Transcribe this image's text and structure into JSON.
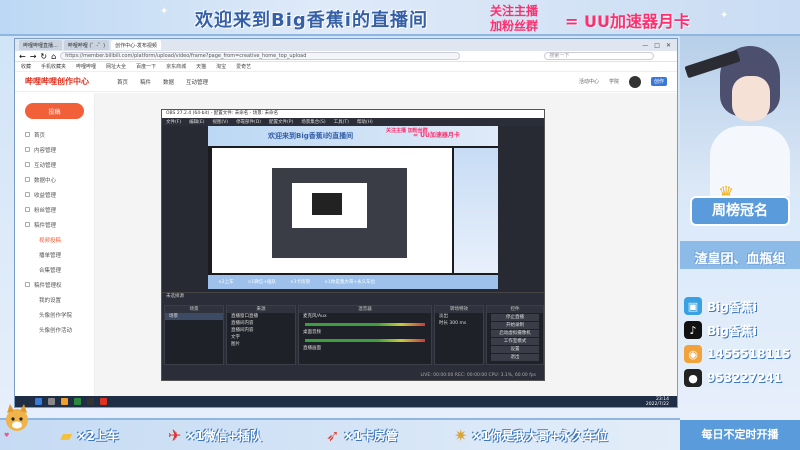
{
  "overlay": {
    "welcome": "欢迎来到Big香蕉i的直播间",
    "promo_line1": "关注主播",
    "promo_line2": "加粉丝群",
    "promo_reward": "= UU加速器月卡"
  },
  "browser": {
    "tabs": [
      "哔哩哔哩直播...",
      "哔哩哔哩 (゜-゜)",
      "创作中心-发布视频"
    ],
    "url": "https://member.bilibili.com/platform/upload/video/frame?page_from=creative_home_top_upload",
    "search_placeholder": "搜索一下",
    "bookmarks": [
      "收藏",
      "手机收藏夹",
      "哔哩哔哩",
      "网址大全",
      "百度一下",
      "京东商城",
      "天猫",
      "淘宝",
      "爱奇艺"
    ],
    "site_logo": "哔哩哔哩创作中心",
    "site_nav": [
      "首页",
      "稿件",
      "数据",
      "互动管理"
    ],
    "site_user_links": [
      "活动中心",
      "学院"
    ],
    "site_badge": "创作"
  },
  "sidebar": {
    "publish_label": "投稿",
    "items": [
      {
        "label": "首页",
        "sub": false,
        "active": false
      },
      {
        "label": "内容管理",
        "sub": false,
        "active": false
      },
      {
        "label": "互动管理",
        "sub": false,
        "active": false
      },
      {
        "label": "数据中心",
        "sub": false,
        "active": false
      },
      {
        "label": "收益管理",
        "sub": false,
        "active": false
      },
      {
        "label": "粉丝管理",
        "sub": false,
        "active": false
      },
      {
        "label": "稿件管理",
        "sub": false,
        "active": false
      },
      {
        "label": "视频投稿",
        "sub": true,
        "active": true
      },
      {
        "label": "播单管理",
        "sub": true,
        "active": false
      },
      {
        "label": "合集管理",
        "sub": true,
        "active": false
      },
      {
        "label": "稿件管理权",
        "sub": false,
        "active": false
      },
      {
        "label": "我的设置",
        "sub": true,
        "active": false
      },
      {
        "label": "头像创作学院",
        "sub": true,
        "active": false
      },
      {
        "label": "头像创作活动",
        "sub": true,
        "active": false
      }
    ]
  },
  "obs": {
    "title": "OBS 27.2.4 (64-bit) - 配置文件: 未命名 - 场景: 未命名",
    "menu": [
      "文件(F)",
      "编辑(E)",
      "视图(V)",
      "停靠部件(D)",
      "配置文件(P)",
      "场景集合(S)",
      "工具(T)",
      "帮助(H)"
    ],
    "scene_bar": "未选择源",
    "docks": {
      "scenes": {
        "title": "场景",
        "items": [
          "场景"
        ]
      },
      "sources": {
        "title": "来源",
        "items": [
          "直播窗口直播",
          "直播间内容",
          "直播间内容",
          "文字",
          "图片"
        ]
      },
      "mixer": {
        "title": "混音器",
        "items": [
          "麦克风/Aux",
          "桌面音频",
          "直播画面"
        ]
      },
      "transitions": {
        "title": "转场特效",
        "items": [
          "淡出",
          "时长 300 ms"
        ]
      },
      "controls": {
        "title": "控件",
        "buttons": [
          "停止直播",
          "开始录制",
          "启动虚拟摄像机",
          "工作室模式",
          "设置",
          "退出"
        ]
      }
    },
    "status": "LIVE: 00:00:00   REC: 00:00:00   CPU: 3.1%, 60.00 fps",
    "nested_welcome": "欢迎来到Big香蕉i的直播间",
    "nested_promo": "关注主播 加粉丝群",
    "nested_reward": "= UU加速器月卡"
  },
  "taskbar": {
    "time": "23:14",
    "date": "2022/7/22"
  },
  "right_panel": {
    "rank_title": "周榜冠名",
    "rank_names": "渣皇团、血瓶组",
    "social": [
      {
        "icon": "bilibili-icon",
        "text": "Big香蕉i",
        "color": "#3aa0e4"
      },
      {
        "icon": "douyin-icon",
        "text": "Big香蕉i",
        "color": "#111111"
      },
      {
        "icon": "kuaishou-icon",
        "text": "1455518115",
        "color": "#f2a23a"
      },
      {
        "icon": "qq-icon",
        "text": "953227241",
        "color": "#222222"
      }
    ],
    "schedule": "每日不定时开播"
  },
  "ticker": {
    "items": [
      {
        "icon": "gold-bar-icon",
        "text": "×2上车"
      },
      {
        "icon": "plane-icon",
        "text": "×1微信+插队"
      },
      {
        "icon": "rocket-icon",
        "text": "×1卡房管"
      },
      {
        "icon": "dragon-icon",
        "text": "×1你是我大哥+永久车位"
      }
    ]
  },
  "colors": {
    "accent": "#f2603a",
    "overlay_blue": "#5a9bdc",
    "promo_pink": "#ff2f6e"
  }
}
